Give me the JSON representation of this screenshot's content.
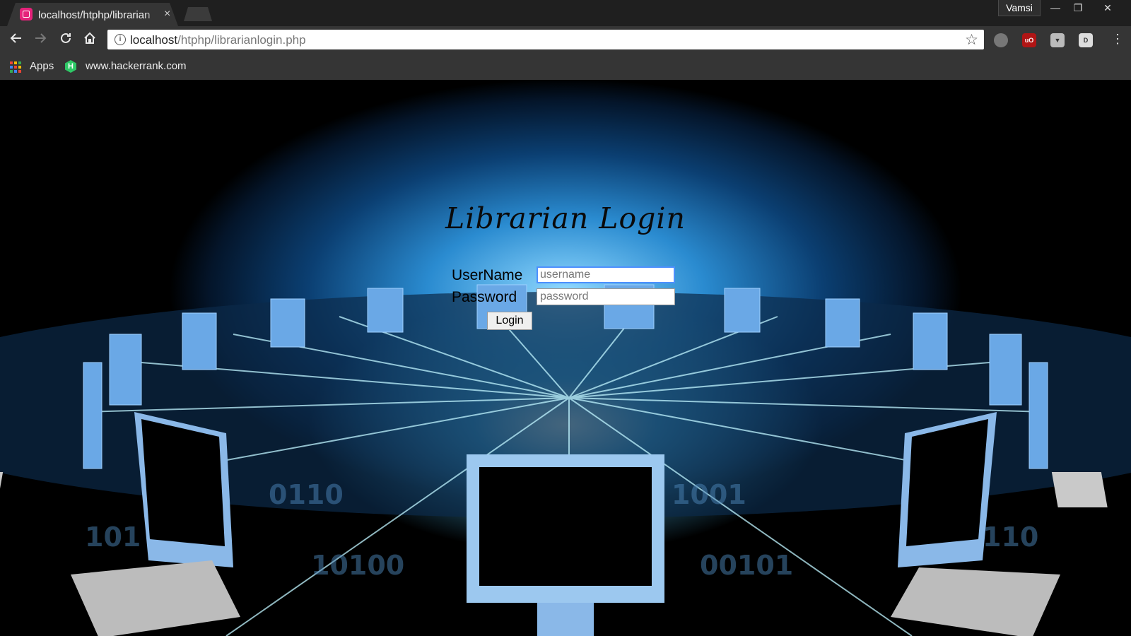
{
  "browser": {
    "tab_title": "localhost/htphp/librarian",
    "tab_close": "×",
    "profile_name": "Vamsi",
    "window_minimize": "—",
    "window_restore": "❐",
    "window_close": "✕",
    "url_host": "localhost",
    "url_path": "/htphp/librarianlogin.php",
    "bookmarks": [
      {
        "label": "Apps",
        "icon": "apps-grid-icon"
      },
      {
        "label": "www.hackerrank.com",
        "icon": "hackerrank-icon"
      }
    ],
    "extensions": [
      "globe-icon",
      "ublock-origin-icon",
      "shield-icon",
      "dictionary-icon"
    ],
    "colors": {
      "tab_bar": "#1f1f1f",
      "toolbar": "#353535",
      "favicon": "#e5227a"
    }
  },
  "page": {
    "title": "Librarian Login",
    "username_label": "UserName",
    "username_placeholder": "username",
    "password_label": "Password",
    "password_placeholder": "password",
    "login_button": "Login",
    "background_description_colors": {
      "glow": "#8fd8ff",
      "deep": "#04152a"
    }
  }
}
